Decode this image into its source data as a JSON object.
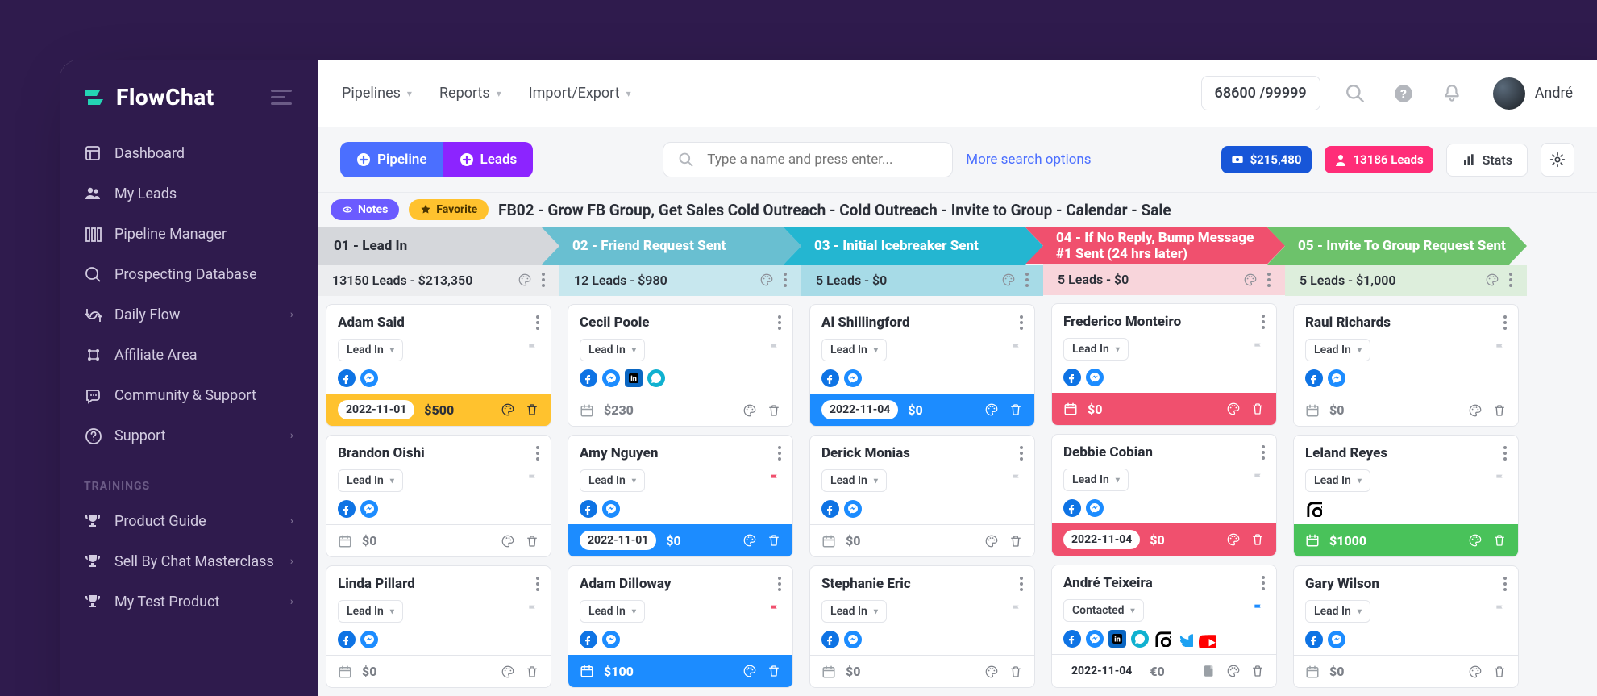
{
  "brand": {
    "name": "FlowChat"
  },
  "sidebar": {
    "items": [
      {
        "label": "Dashboard"
      },
      {
        "label": "My Leads"
      },
      {
        "label": "Pipeline Manager"
      },
      {
        "label": "Prospecting Database"
      },
      {
        "label": "Daily Flow",
        "expandable": true
      },
      {
        "label": "Affiliate Area"
      },
      {
        "label": "Community & Support"
      },
      {
        "label": "Support",
        "expandable": true
      }
    ],
    "trainings_heading": "TRAININGS",
    "trainings": [
      {
        "label": "Product Guide",
        "expandable": true
      },
      {
        "label": "Sell By Chat Masterclass",
        "expandable": true
      },
      {
        "label": "My Test Product",
        "expandable": true
      }
    ]
  },
  "topbar": {
    "nav": [
      {
        "label": "Pipelines"
      },
      {
        "label": "Reports"
      },
      {
        "label": "Import/Export"
      }
    ],
    "counter": "68600 /99999",
    "username": "André"
  },
  "toolbar": {
    "pipeline_btn": "Pipeline",
    "leads_btn": "Leads",
    "search_placeholder": "Type a name and press enter...",
    "more_search": "More search options",
    "total_value": "$215,480",
    "total_leads": "13186 Leads",
    "stats": "Stats"
  },
  "pipe": {
    "notes_label": "Notes",
    "favorite_label": "Favorite",
    "name": "FB02 - Grow FB Group, Get Sales Cold Outreach - Cold Outreach - Invite to Group - Calendar - Sale"
  },
  "columns": [
    {
      "title": "01 - Lead In",
      "summary": "13150 Leads - $213,350",
      "hdr_color": "#D5D7DB",
      "sub_color": "#ECEDEF",
      "hdr_text": "#2B2F38",
      "cards": [
        {
          "name": "Adam Said",
          "stage": "Lead In",
          "icons": [
            "fb",
            "msg"
          ],
          "foot_style": "yellow",
          "date": "2022-11-01",
          "date_pill": true,
          "price": "$500"
        },
        {
          "name": "Brandon Oishi",
          "stage": "Lead In",
          "icons": [
            "fb",
            "msg"
          ],
          "foot_style": "default",
          "price": "$0"
        },
        {
          "name": "Linda Pillard",
          "stage": "Lead In",
          "icons": [
            "fb",
            "msg"
          ],
          "foot_style": "default",
          "price": "$0"
        }
      ]
    },
    {
      "title": "02 - Friend Request Sent",
      "summary": "12 Leads - $980",
      "hdr_color": "#69BFD1",
      "sub_color": "#C7E7EE",
      "cards": [
        {
          "name": "Cecil Poole",
          "stage": "Lead In",
          "icons": [
            "fb",
            "msg",
            "li",
            "bubble"
          ],
          "foot_style": "default",
          "price": "$230"
        },
        {
          "name": "Amy Nguyen",
          "stage": "Lead In",
          "icons": [
            "fb",
            "msg"
          ],
          "flag": "red",
          "foot_style": "blue",
          "date": "2022-11-01",
          "date_pill": true,
          "price": "$0"
        },
        {
          "name": "Adam Dilloway",
          "stage": "Lead In",
          "icons": [
            "fb",
            "msg"
          ],
          "flag": "red",
          "foot_style": "blue",
          "price": "$100"
        }
      ]
    },
    {
      "title": "03 - Initial Icebreaker Sent",
      "summary": "5 Leads - $0",
      "hdr_color": "#24B6D1",
      "sub_color": "#A7DBE7",
      "cards": [
        {
          "name": "Al Shillingford",
          "stage": "Lead In",
          "icons": [
            "fb",
            "msg"
          ],
          "foot_style": "blue",
          "date": "2022-11-04",
          "date_pill": true,
          "price": "$0"
        },
        {
          "name": "Derick Monias",
          "stage": "Lead In",
          "icons": [
            "fb",
            "msg"
          ],
          "foot_style": "default",
          "price": "$0"
        },
        {
          "name": "Stephanie Eric",
          "stage": "Lead In",
          "icons": [
            "fb",
            "msg"
          ],
          "foot_style": "default",
          "price": "$0"
        }
      ]
    },
    {
      "title": "04 - If No Reply, Bump Message #1 Sent (24 hrs later)",
      "summary": "5 Leads - $0",
      "hdr_color": "#F0506E",
      "sub_color": "#F8D5DB",
      "cards": [
        {
          "name": "Frederico Monteiro",
          "stage": "Lead In",
          "icons": [
            "fb",
            "msg"
          ],
          "foot_style": "red",
          "price": "$0"
        },
        {
          "name": "Debbie Cobian",
          "stage": "Lead In",
          "icons": [
            "fb",
            "msg"
          ],
          "foot_style": "red",
          "date": "2022-11-04",
          "date_pill": true,
          "price": "$0"
        },
        {
          "name": "André Teixeira",
          "stage": "Contacted",
          "icons": [
            "fb",
            "msg",
            "li",
            "bubble",
            "ig",
            "tw",
            "yt"
          ],
          "flag": "blue",
          "foot_style": "default",
          "date": "2022-11-04",
          "date_pill": false,
          "price": "€0",
          "extra_note": true
        }
      ]
    },
    {
      "title": "05 - Invite To Group Request Sent",
      "summary": "5 Leads - $1,000",
      "hdr_color": "#6DC26B",
      "sub_color": "#DDEEDC",
      "cards": [
        {
          "name": "Raul Richards",
          "stage": "Lead In",
          "icons": [
            "fb",
            "msg"
          ],
          "foot_style": "default",
          "price": "$0"
        },
        {
          "name": "Leland Reyes",
          "stage": "Lead In",
          "icons": [
            "ig"
          ],
          "foot_style": "green",
          "price": "$1000"
        },
        {
          "name": "Gary Wilson",
          "stage": "Lead In",
          "icons": [
            "fb",
            "msg"
          ],
          "foot_style": "default",
          "price": "$0"
        }
      ]
    }
  ]
}
